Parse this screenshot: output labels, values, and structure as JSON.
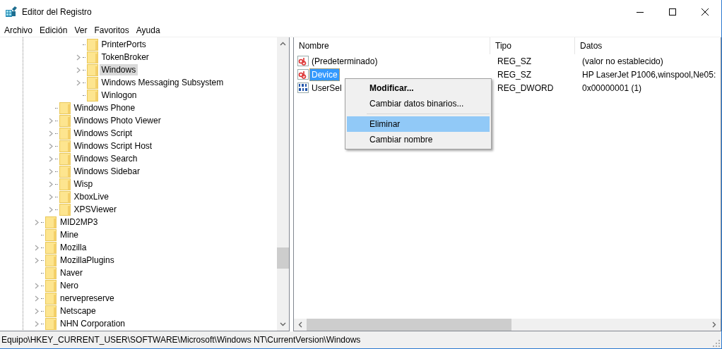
{
  "window": {
    "title": "Editor del Registro"
  },
  "menu": [
    "Archivo",
    "Edición",
    "Ver",
    "Favoritos",
    "Ayuda"
  ],
  "tree": [
    {
      "children": [
        {
          "children": [
            {
              "children": [
                {
                  "label": "PrinterPorts",
                  "expandable": false,
                  "selected": false
                },
                {
                  "label": "TokenBroker",
                  "expandable": true,
                  "selected": false
                },
                {
                  "label": "Windows",
                  "expandable": true,
                  "selected": true
                },
                {
                  "label": "Windows Messaging Subsystem",
                  "expandable": true,
                  "selected": false
                },
                {
                  "label": "Winlogon",
                  "expandable": false,
                  "selected": false
                }
              ]
            }
          ]
        },
        {
          "label": "Windows Phone",
          "expandable": false,
          "selected": false
        },
        {
          "label": "Windows Photo Viewer",
          "expandable": true,
          "selected": false
        },
        {
          "label": "Windows Script",
          "expandable": true,
          "selected": false
        },
        {
          "label": "Windows Script Host",
          "expandable": true,
          "selected": false
        },
        {
          "label": "Windows Search",
          "expandable": true,
          "selected": false
        },
        {
          "label": "Windows Sidebar",
          "expandable": true,
          "selected": false
        },
        {
          "label": "Wisp",
          "expandable": true,
          "selected": false
        },
        {
          "label": "XboxLive",
          "expandable": true,
          "selected": false
        },
        {
          "label": "XPSViewer",
          "expandable": true,
          "selected": false
        }
      ]
    },
    {
      "label": "MID2MP3",
      "expandable": true,
      "selected": false
    },
    {
      "label": "Mine",
      "expandable": false,
      "selected": false
    },
    {
      "label": "Mozilla",
      "expandable": true,
      "selected": false
    },
    {
      "label": "MozillaPlugins",
      "expandable": true,
      "selected": false
    },
    {
      "label": "Naver",
      "expandable": false,
      "selected": false
    },
    {
      "label": "Nero",
      "expandable": true,
      "selected": false
    },
    {
      "label": "nervepreserve",
      "expandable": true,
      "selected": false
    },
    {
      "label": "Netscape",
      "expandable": true,
      "selected": false
    },
    {
      "label": "NHN Corporation",
      "expandable": true,
      "selected": false
    }
  ],
  "values": {
    "columns": [
      "Nombre",
      "Tipo",
      "Datos"
    ],
    "rows": [
      {
        "kind": "string",
        "name": "(Predeterminado)",
        "type": "REG_SZ",
        "data": "(valor no establecido)",
        "selected": false
      },
      {
        "kind": "string",
        "name": "Device",
        "type": "REG_SZ",
        "data": "HP LaserJet P1006,winspool,Ne05:",
        "selected": true
      },
      {
        "kind": "binary",
        "name": "UserSel",
        "type": "REG_DWORD",
        "data": "0x00000001 (1)",
        "selected": false
      }
    ]
  },
  "context_menu": [
    {
      "kind": "item",
      "label": "Modificar...",
      "default": true,
      "selected": false
    },
    {
      "kind": "item",
      "label": "Cambiar datos binarios...",
      "default": false,
      "selected": false
    },
    {
      "kind": "separator"
    },
    {
      "kind": "item",
      "label": "Eliminar",
      "default": false,
      "selected": true
    },
    {
      "kind": "item",
      "label": "Cambiar nombre",
      "default": false,
      "selected": false
    }
  ],
  "status_bar": "Equipo\\HKEY_CURRENT_USER\\SOFTWARE\\Microsoft\\Windows NT\\CurrentVersion\\Windows"
}
